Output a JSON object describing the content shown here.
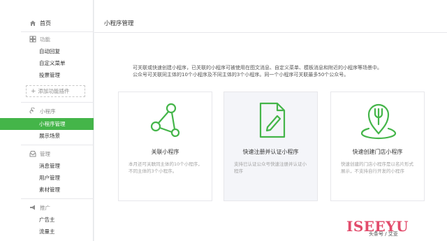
{
  "sidebar": {
    "home_label": "首页",
    "groups": {
      "function": {
        "title": "功能",
        "items": [
          "自动回复",
          "自定义菜单",
          "投票管理"
        ],
        "add_plugin": "添加功能插件"
      },
      "miniprogram": {
        "title": "小程序",
        "items": [
          "小程序管理",
          "展示场景"
        ]
      },
      "manage": {
        "title": "管理",
        "items": [
          "消息管理",
          "用户管理",
          "素材管理"
        ]
      },
      "promote": {
        "title": "推广",
        "items": [
          "广告主",
          "流量主"
        ]
      }
    }
  },
  "main": {
    "title": "小程序管理",
    "description": [
      "可关联或快速创建小程序，已关联的小程序可被使用在图文消息、自定义菜单、模板消息和附近的小程序等场景中。",
      "公众号可关联同主体的10个小程序及不同主体的3个小程序。同一个小程序可关联最多50个公众号。"
    ],
    "cards": [
      {
        "title": "关联小程序",
        "desc": "本月还可关联同主体的10个小程序，不同主体的3个小程序。",
        "icon": "network-link-icon"
      },
      {
        "title": "快速注册并认证小程序",
        "desc": "支持已认证公众号快速注册并认证小程序",
        "icon": "document-pen-icon"
      },
      {
        "title": "快速创建门店小程序",
        "desc": "快速创建的门店小程序是以名片形式展示，不支持自行开发的小程序",
        "icon": "map-pin-fork-icon"
      }
    ]
  },
  "watermark": {
    "brand": "ISEEYU",
    "sub": "头条号 / 艾亚"
  },
  "colors": {
    "accent": "#44b549",
    "icon_green": "#44b549"
  }
}
